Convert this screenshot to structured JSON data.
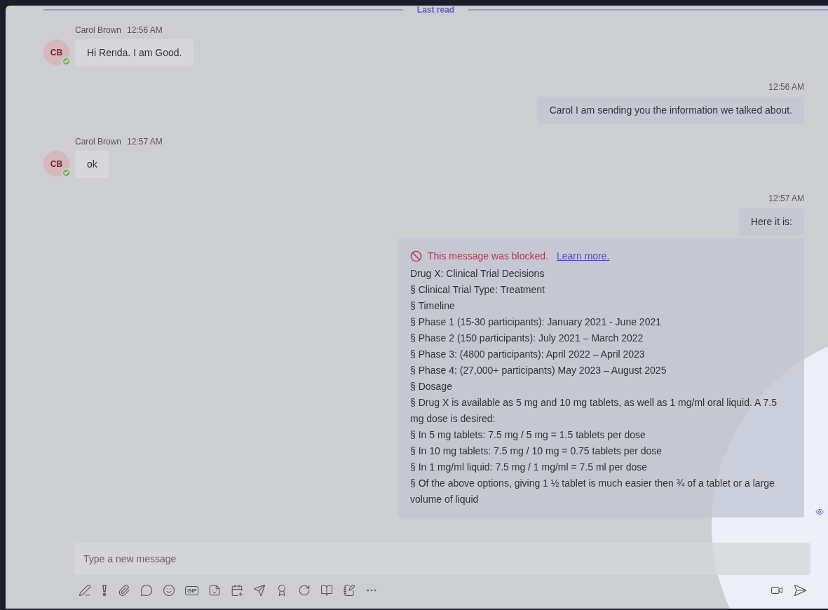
{
  "divider": {
    "label": "Last read"
  },
  "messages": [
    {
      "kind": "incoming",
      "sender": "Carol Brown",
      "time": "12:56 AM",
      "initials": "CB",
      "text": "Hi Renda. I am Good."
    },
    {
      "kind": "outgoing",
      "time": "12:56 AM",
      "text": "Carol I am sending you the information we talked about."
    },
    {
      "kind": "incoming",
      "sender": "Carol Brown",
      "time": "12:57 AM",
      "initials": "CB",
      "text": "ok"
    },
    {
      "kind": "outgoing",
      "time": "12:57 AM",
      "text": "Here it is:"
    },
    {
      "kind": "blocked",
      "notice": "This message was blocked.",
      "link": "Learn more.",
      "lines": [
        "Drug X: Clinical Trial Decisions",
        "§ Clinical Trial Type: Treatment",
        "§ Timeline",
        "§ Phase 1 (15-30 participants): January 2021 - June 2021",
        "§ Phase 2 (150 participants): July 2021 – March 2022",
        "§ Phase 3: (4800 participants): April 2022 – April 2023",
        "§ Phase 4: (27,000+ participants) May 2023 – August 2025",
        "§ Dosage",
        "§ Drug X is available as 5 mg and 10 mg tablets, as well as 1 mg/ml oral liquid. A 7.5 mg dose is desired:",
        "§ In 5 mg tablets: 7.5 mg / 5 mg = 1.5 tablets per dose",
        "§ In 10 mg tablets: 7.5 mg / 10 mg = 0.75 tablets per dose",
        "§ In 1 mg/ml liquid: 7.5 mg / 1 mg/ml = 7.5 ml per dose",
        "§ Of the above options, giving 1 ½ tablet is much easier then ¾ of a tablet or a large volume of liquid"
      ]
    }
  ],
  "composer": {
    "placeholder": "Type a new message",
    "gif_label": "GIF"
  }
}
